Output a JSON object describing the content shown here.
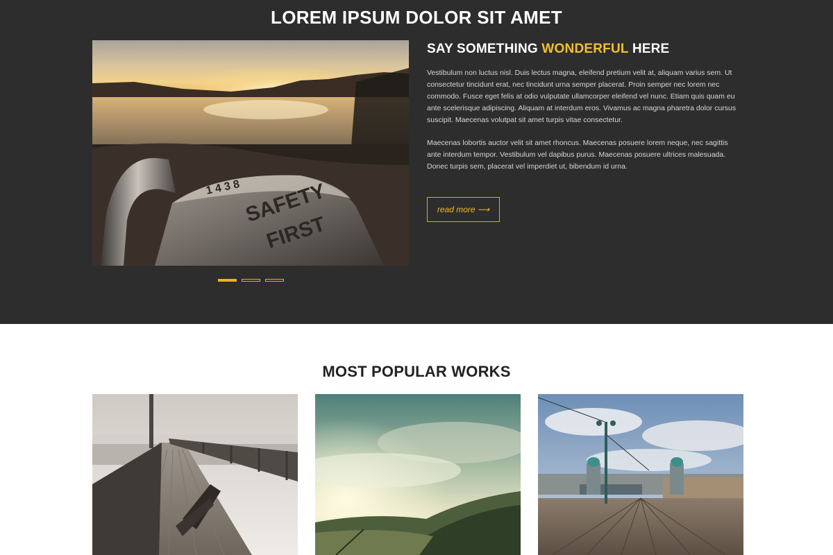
{
  "hero": {
    "title": "LOREM IPSUM DOLOR SIT AMET",
    "image_icon": "padlock-sunset-photo",
    "heading_part1": "SAY SOMETHING ",
    "heading_accent": "WONDERFUL",
    "heading_part2": " HERE",
    "paragraph1": "Vestibulum non luctus nisl. Duis lectus magna, eleifend pretium velit at, aliquam varius sem. Ut consectetur tincidunt erat, nec tincidunt urna semper placerat. Proin semper nec lorem nec commodo. Fusce eget felis at odio vulputate ullamcorper eleifend vel nunc. Etiam quis quam eu ante scelerisque adipiscing. Aliquam at interdum eros. Vivamus ac magna pharetra dolor cursus suscipit. Maecenas volutpat sit amet turpis vitae consectetur.",
    "paragraph2": "Maecenas lobortis auctor velit sit amet rhoncus. Maecenas posuere lorem neque, nec sagittis ante interdum tempor. Vestibulum vel dapibus purus. Maecenas posuere ultrices malesuada. Donec turpis sem, placerat vel imperdiet ut, bibendum id urna.",
    "read_more_label": "read more ⟶",
    "padlock_engraving_1": "SAFETY",
    "padlock_engraving_2": "FIRST",
    "padlock_number": "1 4 3 8",
    "slider_dots_total": 3,
    "slider_dots_active": 1
  },
  "works": {
    "title": "MOST POPULAR WORKS",
    "items": [
      {
        "icon": "pier-bench-photo"
      },
      {
        "icon": "cloudy-valley-photo"
      },
      {
        "icon": "boardwalk-lamps-photo"
      }
    ]
  },
  "colors": {
    "hero_bg": "#2d2d2d",
    "accent": "#f2c12e",
    "page_bg": "#ffffff"
  }
}
